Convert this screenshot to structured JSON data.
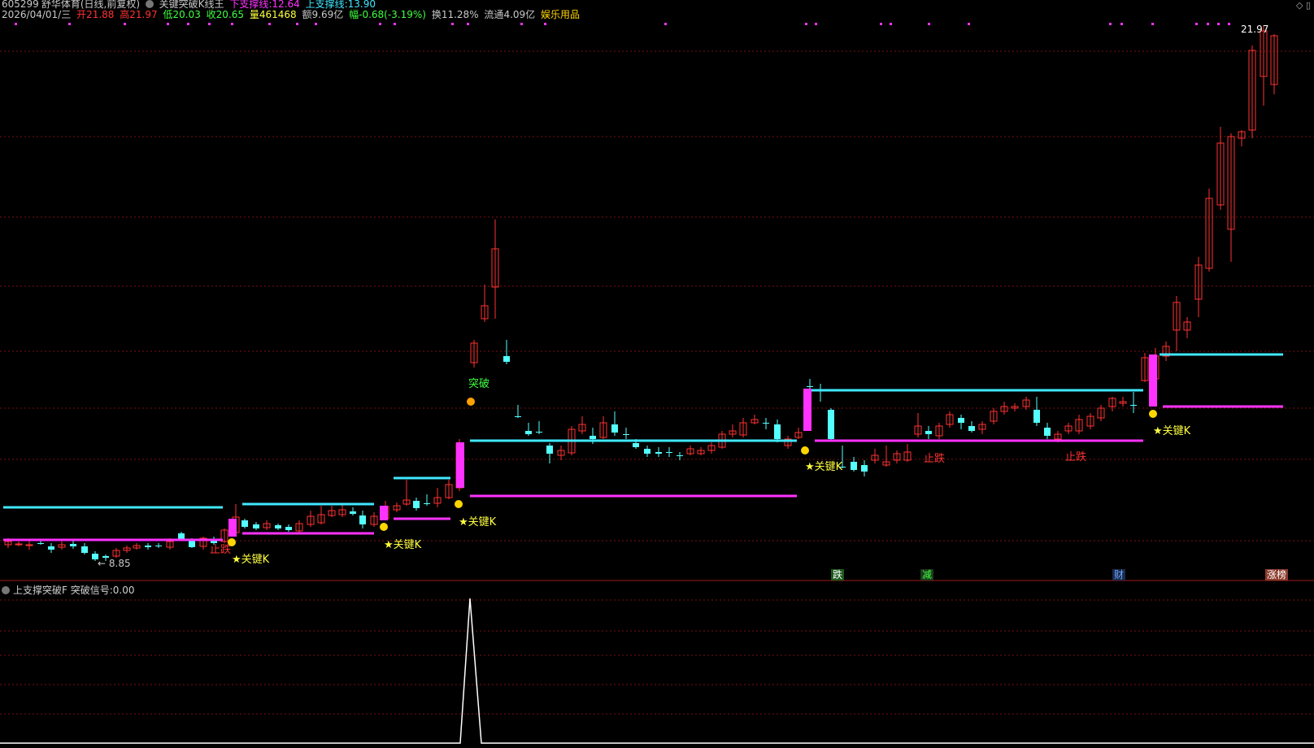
{
  "header": {
    "code": "605299",
    "name": "舒华体育",
    "period": "(日线,前复权)",
    "indicator_name": "关键突破K线王",
    "lower_support_label": "下支撑线:",
    "lower_support_value": "12.64",
    "upper_support_label": "上支撑线:",
    "upper_support_value": "13.90",
    "date": "2026/04/01/三",
    "open_label": "开",
    "open": "21.88",
    "high_label": "高",
    "high": "21.97",
    "low_label": "低",
    "low": "20.03",
    "close_label": "收",
    "close": "20.65",
    "volume_label": "量",
    "volume": "461468",
    "amount_label": "额",
    "amount": "9.69亿",
    "change_label": "幅",
    "change": "-0.68(-3.19%)",
    "turnover_label": "换",
    "turnover": "11.28%",
    "float_label": "流通",
    "float_value": "4.09亿",
    "sector": "娱乐用品"
  },
  "main_chart": {
    "price_max_label": "21.97",
    "price_min_label": "8.85",
    "signal_labels": {
      "key_k": "★关键K",
      "stop_fall": "止跌",
      "breakout": "突破"
    },
    "colors": {
      "up": "#ff3232",
      "down": "#54ffff",
      "magenta": "#ff32ff",
      "cyan": "#40e8ff",
      "yellow": "#ffff40",
      "grid": "#7a1010"
    }
  },
  "event_badges": [
    {
      "label": "跌",
      "color": "#ffffff",
      "bg": "#1c5a1c"
    },
    {
      "label": "减",
      "color": "#40ff40",
      "bg": "#1c3a1c"
    },
    {
      "label": "财",
      "color": "#6aa8ff",
      "bg": "#1c2a4a"
    },
    {
      "label": "涨榜",
      "color": "#ffffff",
      "bg": "#8a3a2a"
    }
  ],
  "sub_chart": {
    "title": "上支撑突破F",
    "signal_label": "突破信号:",
    "signal_value": "0.00"
  }
}
